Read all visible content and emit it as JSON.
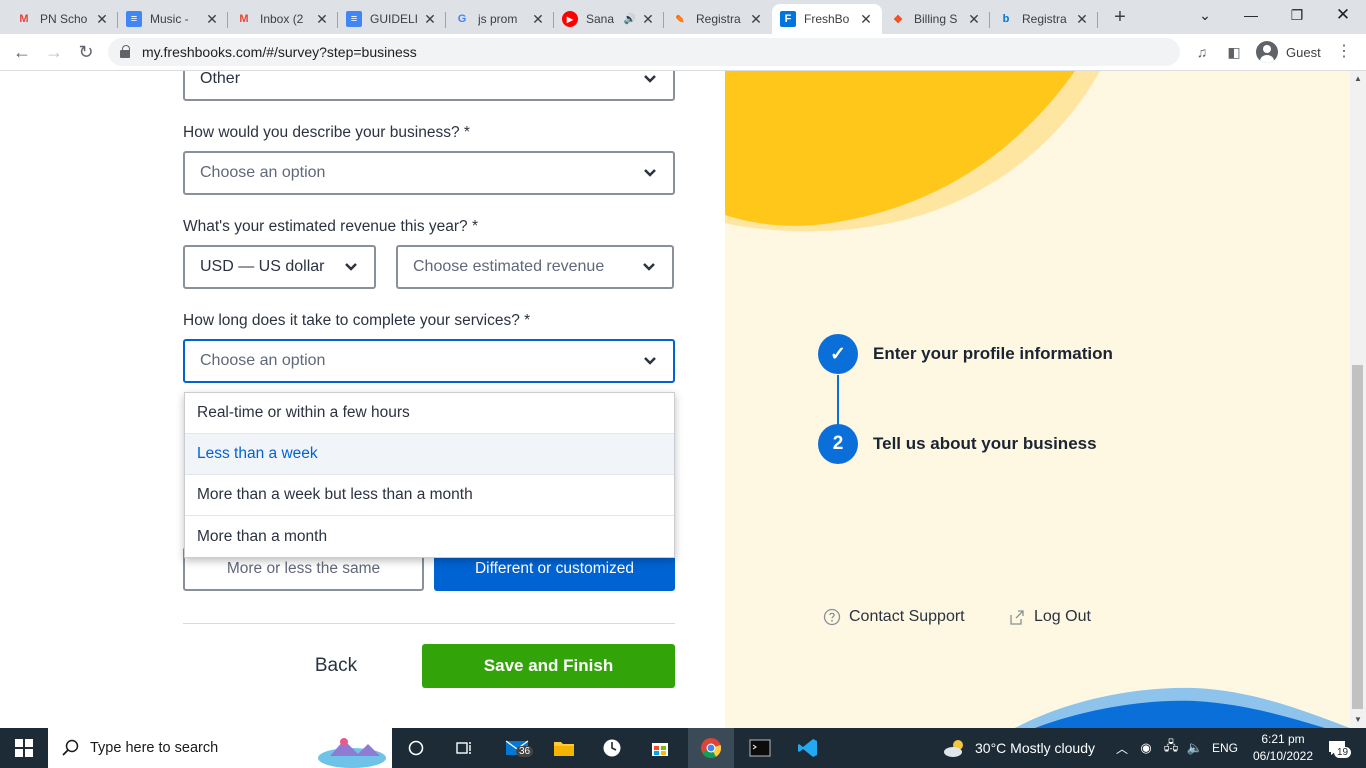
{
  "browser": {
    "tabs": [
      {
        "title": "PN Scho",
        "favicon": "gmail-icon",
        "color": "#ea4335"
      },
      {
        "title": "Music - ",
        "favicon": "docs-icon",
        "color": "#4285f4"
      },
      {
        "title": "Inbox (2",
        "favicon": "gmail-icon",
        "color": "#ea4335"
      },
      {
        "title": "GUIDELI",
        "favicon": "docs-icon",
        "color": "#4285f4"
      },
      {
        "title": "js prom",
        "favicon": "google-icon",
        "color": "#4285f4"
      },
      {
        "title": "Sana",
        "favicon": "youtube-icon",
        "color": "#ff0000"
      },
      {
        "title": "Registra",
        "favicon": "pen-icon",
        "color": "#ff6d00"
      },
      {
        "title": "FreshBo",
        "favicon": "freshbooks-icon",
        "color": "#0075dd"
      },
      {
        "title": "Billing S",
        "favicon": "figma-icon",
        "color": "#f24e1e"
      },
      {
        "title": "Registra",
        "favicon": "bing-icon",
        "color": "#0078d4"
      }
    ],
    "url": "my.freshbooks.com/#/survey?step=business",
    "profile": "Guest"
  },
  "form": {
    "industry_value": "Other",
    "q_describe": "How would you describe your business? *",
    "describe_value": "Choose an option",
    "q_revenue": "What's your estimated revenue this year? *",
    "currency_value": "USD — US dollar",
    "revenue_value": "Choose estimated revenue",
    "q_services": "How long does it take to complete your services? *",
    "services_value": "Choose an option",
    "options": [
      "Real-time or within a few hours",
      "Less than a week",
      "More than a week but less than a month",
      "More than a month"
    ],
    "pricing_same": "More or less the same",
    "pricing_custom": "Different or customized",
    "back_label": "Back",
    "save_label": "Save and Finish"
  },
  "sidebar": {
    "step1_mark": "✓",
    "step1_text": "Enter your profile information",
    "step2_number": "2",
    "step2_text": "Tell us about your business",
    "contact_support": "Contact Support",
    "log_out": "Log Out"
  },
  "taskbar": {
    "search_placeholder": "Type here to search",
    "mail_badge": "36",
    "weather": "30°C  Mostly cloudy",
    "language": "ENG",
    "time": "6:21 pm",
    "date": "06/10/2022",
    "notifications": "19"
  },
  "colors": {
    "brand_blue": "#0063d3",
    "save_green": "#33a30a",
    "sidebar_bg": "#fef7e2",
    "blob_yellow": "#ffc71a"
  }
}
